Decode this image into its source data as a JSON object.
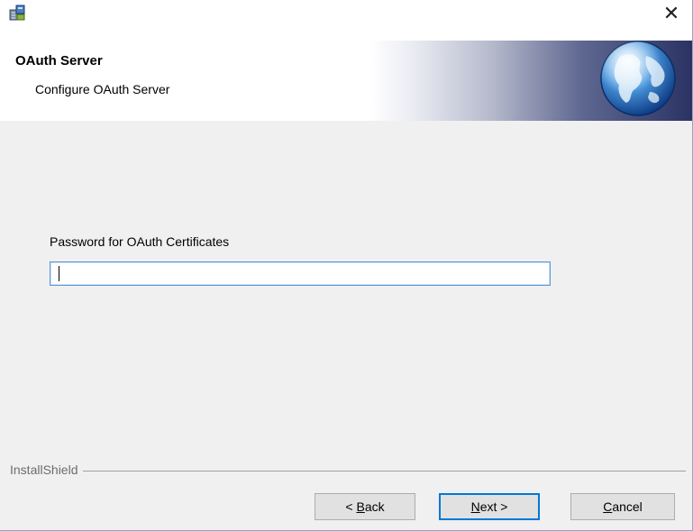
{
  "titlebar": {
    "app_icon": "installer-icon",
    "close_symbol": "✕"
  },
  "header": {
    "title": "OAuth Server",
    "subtitle": "Configure OAuth Server",
    "graphic_icon": "globe-icon"
  },
  "form": {
    "password_label": "Password for OAuth Certificates",
    "password_value": "",
    "password_placeholder": ""
  },
  "footer": {
    "brand": "InstallShield",
    "back": {
      "prefix": "< ",
      "mnemonic": "B",
      "rest": "ack"
    },
    "next": {
      "mnemonic": "N",
      "rest": "ext >"
    },
    "cancel": {
      "mnemonic": "C",
      "rest": "ancel"
    }
  },
  "colors": {
    "window_bg": "#f0f0f0",
    "accent": "#0078d7",
    "header_dark": "#2a3364"
  }
}
